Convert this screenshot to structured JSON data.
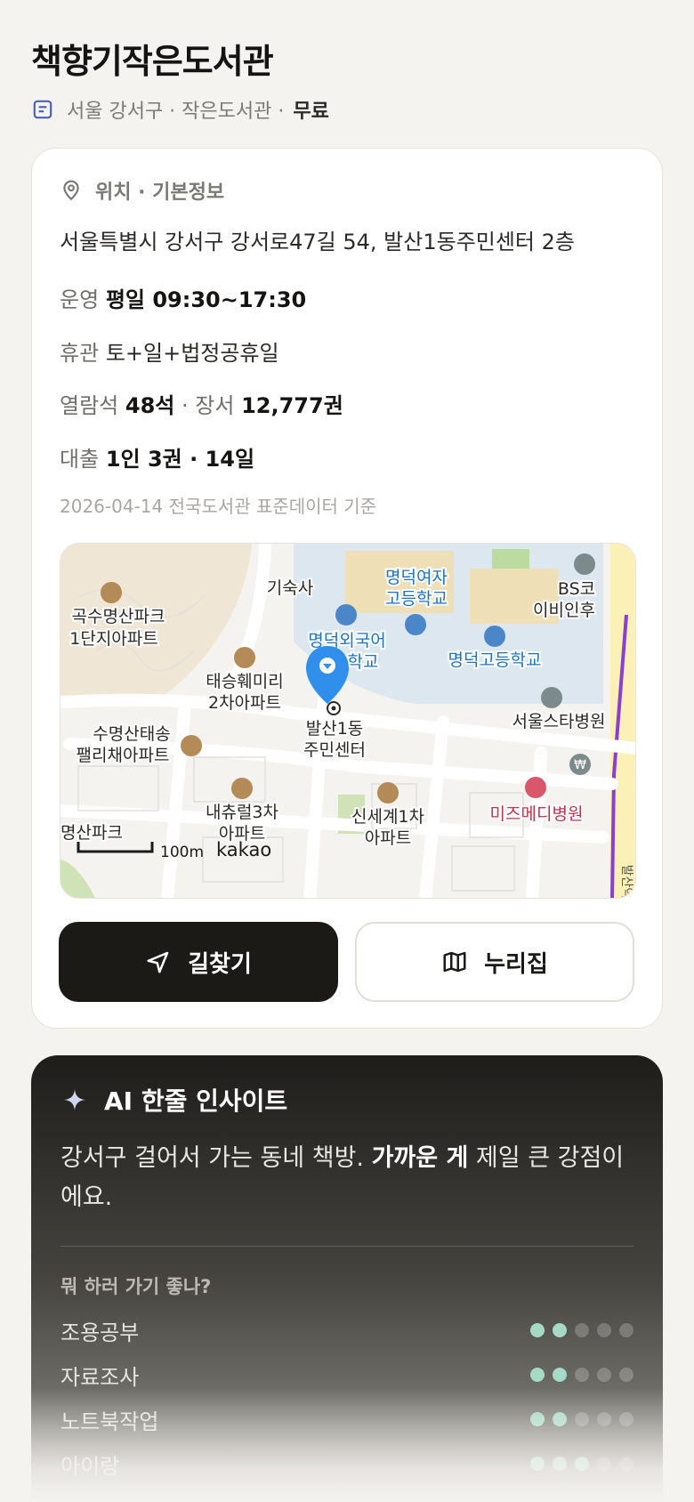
{
  "header": {
    "title": "책향기작은도서관",
    "region": "서울 강서구 · 작은도서관 ·",
    "fee": "무료"
  },
  "info": {
    "section_title": "위치 · 기본정보",
    "address": "서울특별시 강서구 강서로47길 54, 발산1동주민센터 2층",
    "hours_label": "운영",
    "hours_value": "평일 09:30~17:30",
    "closed_label": "휴관",
    "closed_value": "토+일+법정공휴일",
    "seats_label": "열람석",
    "seats_value": "48석",
    "books_sep": "· 장서",
    "books_value": "12,777권",
    "loan_label": "대출",
    "loan_value": "1인 3권 · 14일",
    "stamp": "2026-04-14 전국도서관 표준데이터 기준"
  },
  "map": {
    "labels": {
      "gisuksa": "기숙사",
      "school_girls_1": "명덕여자",
      "school_girls_2": "고등학교",
      "bs_1": "BS코",
      "bs_2": "이비인후",
      "apt_a1": "곡수명산파크",
      "apt_a2": "1단지아파트",
      "foreign_1": "명덕외국어",
      "foreign_2": "학교",
      "school_high": "명덕고등학교",
      "apt_b1": "태승훼미리",
      "apt_b2": "2차아파트",
      "hospital_1": "서울스타병원",
      "center_1": "발산1동",
      "center_2": "주민센터",
      "apt_c1": "수명산태송",
      "apt_c2": "팰리채아파트",
      "apt_d1": "내츄럴3차",
      "apt_d2": "아파트",
      "apt_e1": "신세계1차",
      "apt_e2": "아파트",
      "hospital_2": "미즈메디병원",
      "park": "명산파크",
      "scale": "100m",
      "brand": "kakao",
      "station": "발산역",
      "won": "₩"
    },
    "colors": {
      "school_label": "#1a73c7",
      "hospital_label": "#c0334b",
      "marker": "#2f8fea",
      "subway": "#8a3fd1"
    }
  },
  "buttons": {
    "directions": "길찾기",
    "nurijip": "누리집"
  },
  "ai": {
    "title": "AI 한줄 인사이트",
    "text_a": "강서구 걸어서 가는 동네 책방. ",
    "text_b": "가까운 게",
    "text_c": " 제일 큰 강점이에요.",
    "question": "뭐 하러 가기 좋나?",
    "activities": [
      {
        "name": "조용공부",
        "score": 2
      },
      {
        "name": "자료조사",
        "score": 2
      },
      {
        "name": "노트북작업",
        "score": 2
      },
      {
        "name": "아이랑",
        "score": 3
      }
    ]
  }
}
